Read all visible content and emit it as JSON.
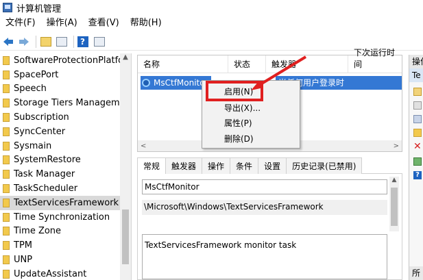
{
  "window": {
    "title": "计算机管理"
  },
  "menu": [
    "文件(F)",
    "操作(A)",
    "查看(V)",
    "帮助(H)"
  ],
  "toolbar": {
    "back_icon": "arrow-left-icon",
    "forward_icon": "arrow-right-icon",
    "help_label": "?"
  },
  "tree": {
    "items": [
      "SoftwareProtectionPlatform",
      "SpacePort",
      "Speech",
      "Storage Tiers Management",
      "Subscription",
      "SyncCenter",
      "Sysmain",
      "SystemRestore",
      "Task Manager",
      "TaskScheduler",
      "TextServicesFramework",
      "Time Synchronization",
      "Time Zone",
      "TPM",
      "UNP",
      "UpdateAssistant"
    ],
    "selected_index": 10,
    "scroll_up": "▲"
  },
  "task_list": {
    "columns": [
      "名称",
      "状态",
      "触发器",
      "下次运行时间"
    ],
    "row": {
      "name": "MsCtfMonitor",
      "trigger": "当任何用户登录时"
    },
    "scroll_left": "<",
    "scroll_right": ">"
  },
  "context_menu": {
    "items": [
      "启用(N)",
      "导出(X)...",
      "属性(P)",
      "删除(D)"
    ],
    "highlighted_index": 0
  },
  "tabs": [
    "常规",
    "触发器",
    "操作",
    "条件",
    "设置",
    "历史记录(已禁用)"
  ],
  "detail": {
    "name": "MsCtfMonitor",
    "path": "\\Microsoft\\Windows\\TextServicesFramework",
    "description": "TextServicesFramework monitor task",
    "scroll_up": "▲"
  },
  "actions": {
    "header": "操作",
    "sub": "Te",
    "bottom": "所",
    "delete_glyph": "✕",
    "help_label": "?"
  }
}
